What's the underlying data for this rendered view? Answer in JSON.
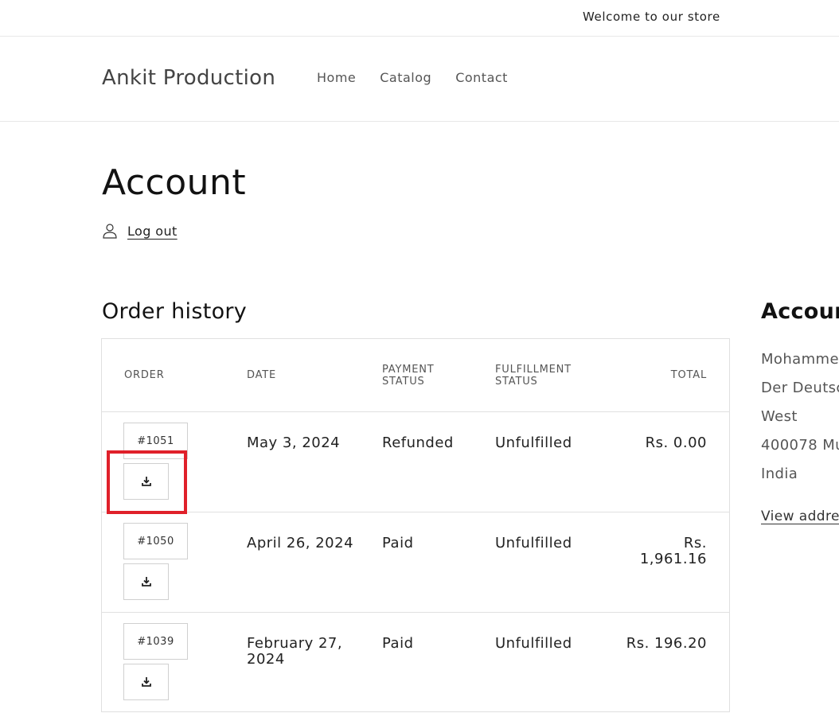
{
  "announcement": {
    "text": "Welcome to our store"
  },
  "header": {
    "logo": "Ankit Production",
    "nav": [
      "Home",
      "Catalog",
      "Contact"
    ]
  },
  "account": {
    "title": "Account",
    "logout_label": "Log out"
  },
  "orders": {
    "title": "Order history",
    "headers": {
      "order": "ORDER",
      "date": "DATE",
      "payment_1": "PAYMENT",
      "payment_2": "STATUS",
      "fulfillment_1": "FULFILLMENT",
      "fulfillment_2": "STATUS",
      "total": "TOTAL"
    },
    "rows": [
      {
        "number": "#1051",
        "date": "May 3, 2024",
        "payment": "Refunded",
        "fulfillment": "Unfulfilled",
        "total": "Rs. 0.00"
      },
      {
        "number": "#1050",
        "date": "April 26, 2024",
        "payment": "Paid",
        "fulfillment": "Unfulfilled",
        "total": "Rs. 1,961.16"
      },
      {
        "number": "#1039",
        "date": "February 27, 2024",
        "payment": "Paid",
        "fulfillment": "Unfulfilled",
        "total": "Rs. 196.20"
      }
    ]
  },
  "account_details": {
    "title": "Account",
    "lines": [
      "Mohammed",
      "Der Deutsc",
      "West",
      "400078 Mu",
      "India"
    ],
    "view_addresses": "View address"
  },
  "colors": {
    "highlight": "#e0202a",
    "border": "#e0e0e0"
  }
}
